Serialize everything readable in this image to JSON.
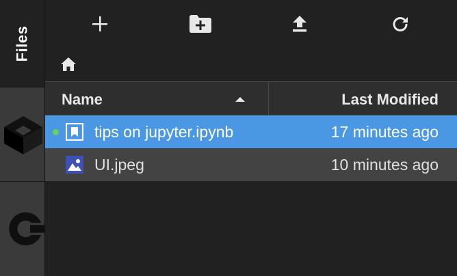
{
  "sidebar": {
    "tabs": [
      {
        "label": "Files",
        "icon": "folder-tab"
      },
      {
        "icon": "cube-icon"
      },
      {
        "icon": "running-sessions-icon"
      }
    ]
  },
  "toolbar": {
    "buttons": [
      {
        "icon": "plus-icon",
        "action": "new-launcher"
      },
      {
        "icon": "new-folder-icon",
        "action": "new-folder"
      },
      {
        "icon": "upload-icon",
        "action": "upload"
      },
      {
        "icon": "refresh-icon",
        "action": "refresh"
      }
    ]
  },
  "breadcrumb": {
    "icon": "home-icon"
  },
  "listing": {
    "columns": {
      "name": "Name",
      "modified": "Last Modified",
      "sort": "ascending"
    },
    "files": [
      {
        "name": "tips on jupyter.ipynb",
        "modified": "17 minutes ago",
        "type": "notebook",
        "running": true,
        "selected": true
      },
      {
        "name": "UI.jpeg",
        "modified": "10 minutes ago",
        "type": "image",
        "running": false,
        "selected": false
      }
    ]
  },
  "colors": {
    "background": "#212121",
    "sidebar": "#3a3a3a",
    "selection": "#4a97e3",
    "running_dot": "#6fce5b",
    "file_icon": "#3f51b5"
  }
}
